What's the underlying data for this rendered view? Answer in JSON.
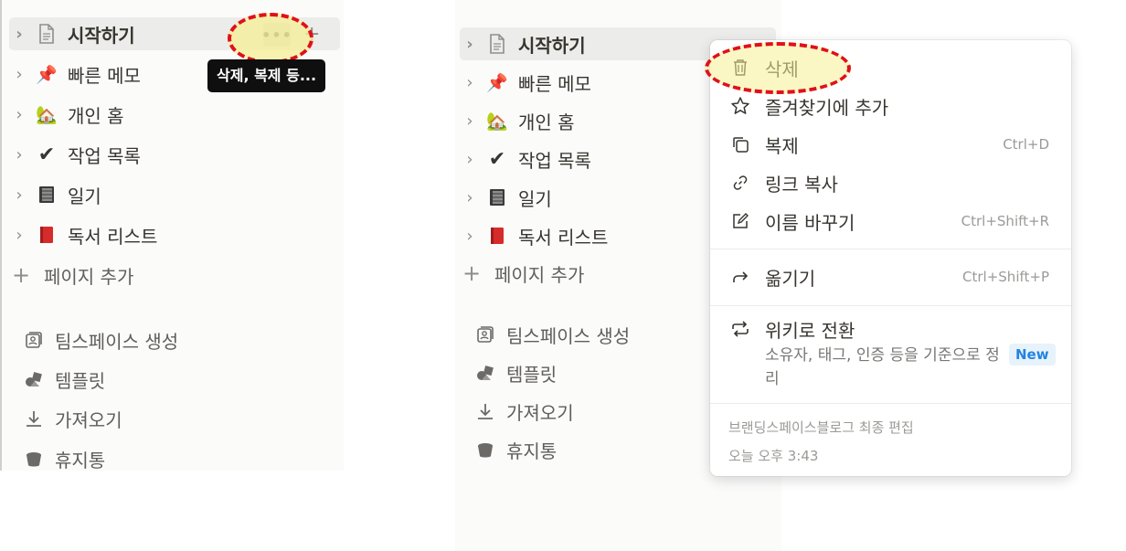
{
  "left": {
    "pages": [
      {
        "label": "시작하기",
        "icon": "page-icon",
        "emoji": ""
      },
      {
        "label": "빠른 메모",
        "icon": "pushpin-icon",
        "emoji": "📌"
      },
      {
        "label": "개인 홈",
        "icon": "house-icon",
        "emoji": "🏡"
      },
      {
        "label": "작업 목록",
        "icon": "checkmark-icon",
        "emoji": "✔"
      },
      {
        "label": "일기",
        "icon": "notebook-icon",
        "emoji": "📓"
      },
      {
        "label": "독서 리스트",
        "icon": "red-book-icon",
        "emoji": "📕"
      }
    ],
    "add_page": "페이지 추가",
    "bottom": [
      {
        "label": "팀스페이스 생성",
        "icon": "teamspace-icon"
      },
      {
        "label": "템플릿",
        "icon": "templates-icon"
      },
      {
        "label": "가져오기",
        "icon": "import-icon"
      },
      {
        "label": "휴지통",
        "icon": "trash-bin-icon"
      }
    ],
    "more_button": "•••",
    "add_button": "+",
    "tooltip": "삭제, 복제 등..."
  },
  "right": {
    "pages": [
      {
        "label": "시작하기",
        "icon": "page-icon",
        "emoji": ""
      },
      {
        "label": "빠른 메모",
        "icon": "pushpin-icon",
        "emoji": "📌"
      },
      {
        "label": "개인 홈",
        "icon": "house-icon",
        "emoji": "🏡"
      },
      {
        "label": "작업 목록",
        "icon": "checkmark-icon",
        "emoji": "✔"
      },
      {
        "label": "일기",
        "icon": "notebook-icon",
        "emoji": "📓"
      },
      {
        "label": "독서 리스트",
        "icon": "red-book-icon",
        "emoji": "📕"
      }
    ],
    "add_page": "페이지 추가",
    "bottom": [
      {
        "label": "팀스페이스 생성",
        "icon": "teamspace-icon"
      },
      {
        "label": "템플릿",
        "icon": "templates-icon"
      },
      {
        "label": "가져오기",
        "icon": "import-icon"
      },
      {
        "label": "휴지통",
        "icon": "trash-bin-icon"
      }
    ]
  },
  "menu": {
    "items": [
      {
        "label": "삭제",
        "icon": "trash-icon",
        "shortcut": ""
      },
      {
        "label": "즐겨찾기에 추가",
        "icon": "star-icon",
        "shortcut": ""
      },
      {
        "label": "복제",
        "icon": "duplicate-icon",
        "shortcut": "Ctrl+D"
      },
      {
        "label": "링크 복사",
        "icon": "link-icon",
        "shortcut": ""
      },
      {
        "label": "이름 바꾸기",
        "icon": "rename-icon",
        "shortcut": "Ctrl+Shift+R"
      },
      {
        "label": "옮기기",
        "icon": "move-arrow-icon",
        "shortcut": "Ctrl+Shift+P"
      },
      {
        "label": "위키로 전환",
        "icon": "wiki-convert-icon",
        "shortcut": ""
      }
    ],
    "wiki_description": "소유자, 태그, 인증 등을 기준으로 정리",
    "new_badge": "New",
    "footer_editor": "브랜딩스페이스블로그 최종 편집",
    "footer_time": "오늘 오후 3:43"
  },
  "colors": {
    "highlight_stroke": "#e0101a",
    "highlight_fill": "#f5f096",
    "badge_text": "#2383e2"
  }
}
